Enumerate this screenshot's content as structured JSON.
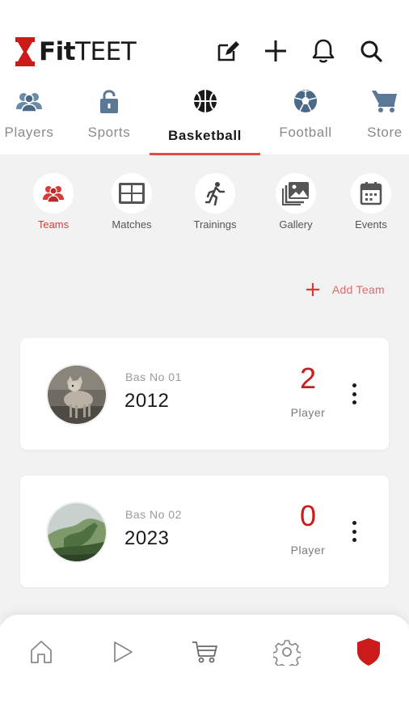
{
  "app": {
    "logo_fit": "Fit",
    "logo_teet": "TEET"
  },
  "header": {
    "actions": [
      "edit-icon",
      "plus-icon",
      "bell-icon",
      "search-icon"
    ]
  },
  "sport_tabs": [
    {
      "label": "Players",
      "icon": "players-icon",
      "active": false
    },
    {
      "label": "Sports",
      "icon": "lock-icon",
      "active": false
    },
    {
      "label": "Basketball",
      "icon": "basketball-icon",
      "active": true
    },
    {
      "label": "Football",
      "icon": "football-icon",
      "active": false
    },
    {
      "label": "Store",
      "icon": "cart-icon",
      "active": false
    }
  ],
  "sub_nav": [
    {
      "label": "Teams",
      "icon": "teams-icon",
      "active": true
    },
    {
      "label": "Matches",
      "icon": "matches-icon",
      "active": false
    },
    {
      "label": "Trainings",
      "icon": "running-icon",
      "active": false
    },
    {
      "label": "Gallery",
      "icon": "gallery-icon",
      "active": false
    },
    {
      "label": "Events",
      "icon": "calendar-icon",
      "active": false
    }
  ],
  "add_team_label": "Add Team",
  "teams": [
    {
      "code": "Bas No 01",
      "year": "2012",
      "count": "2",
      "count_label": "Player",
      "avatar": "wolf-photo"
    },
    {
      "code": "Bas No 02",
      "year": "2023",
      "count": "0",
      "count_label": "Player",
      "avatar": "landscape-photo"
    }
  ],
  "bottom_nav": [
    "home-icon",
    "play-icon",
    "cart-icon",
    "settings-icon",
    "shield-icon"
  ],
  "colors": {
    "accent": "#cc1b1b",
    "accent_light": "#e06a6a",
    "background": "#f2f2f2",
    "tab_underline": "#e34b4b"
  }
}
